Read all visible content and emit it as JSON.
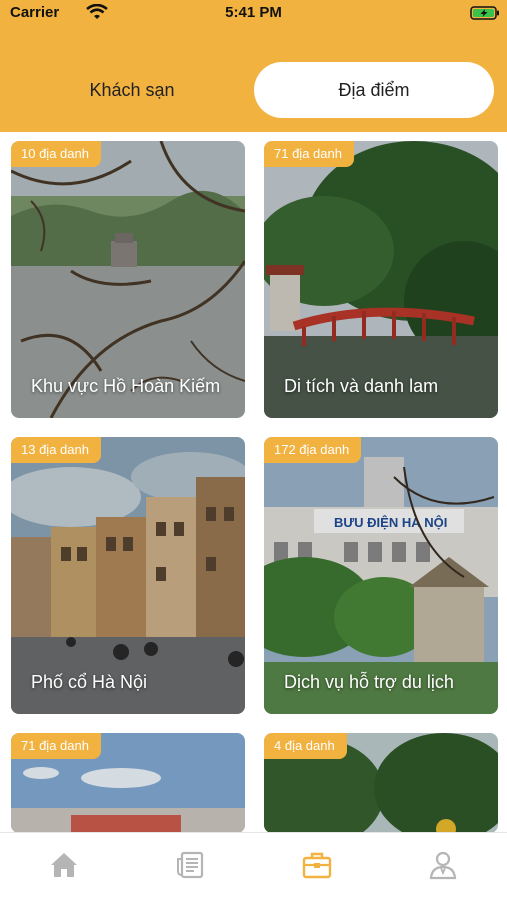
{
  "status_bar": {
    "carrier": "Carrier",
    "time": "5:41 PM"
  },
  "tabs": {
    "hotels": "Khách sạn",
    "places": "Địa điểm",
    "active": "places"
  },
  "cards": [
    {
      "count": "10 địa danh",
      "title": "Khu vực Hồ Hoàn Kiếm"
    },
    {
      "count": "71 địa danh",
      "title": "Di tích và danh lam"
    },
    {
      "count": "13 địa danh",
      "title": "Phố cổ Hà Nội"
    },
    {
      "count": "172 địa danh",
      "title": "Dịch vụ hỗ trợ du lịch"
    },
    {
      "count": "71 địa danh",
      "title": ""
    },
    {
      "count": "4 địa danh",
      "title": ""
    }
  ],
  "photo_signs": {
    "post_office": "BƯU ĐIỆN HÀ NỘI"
  },
  "bottom_nav": {
    "items": [
      "home-icon",
      "news-icon",
      "places-icon",
      "profile-icon"
    ],
    "active_index": 2
  },
  "colors": {
    "accent": "#f2b240",
    "inactive_icon": "#b5b5b5"
  }
}
